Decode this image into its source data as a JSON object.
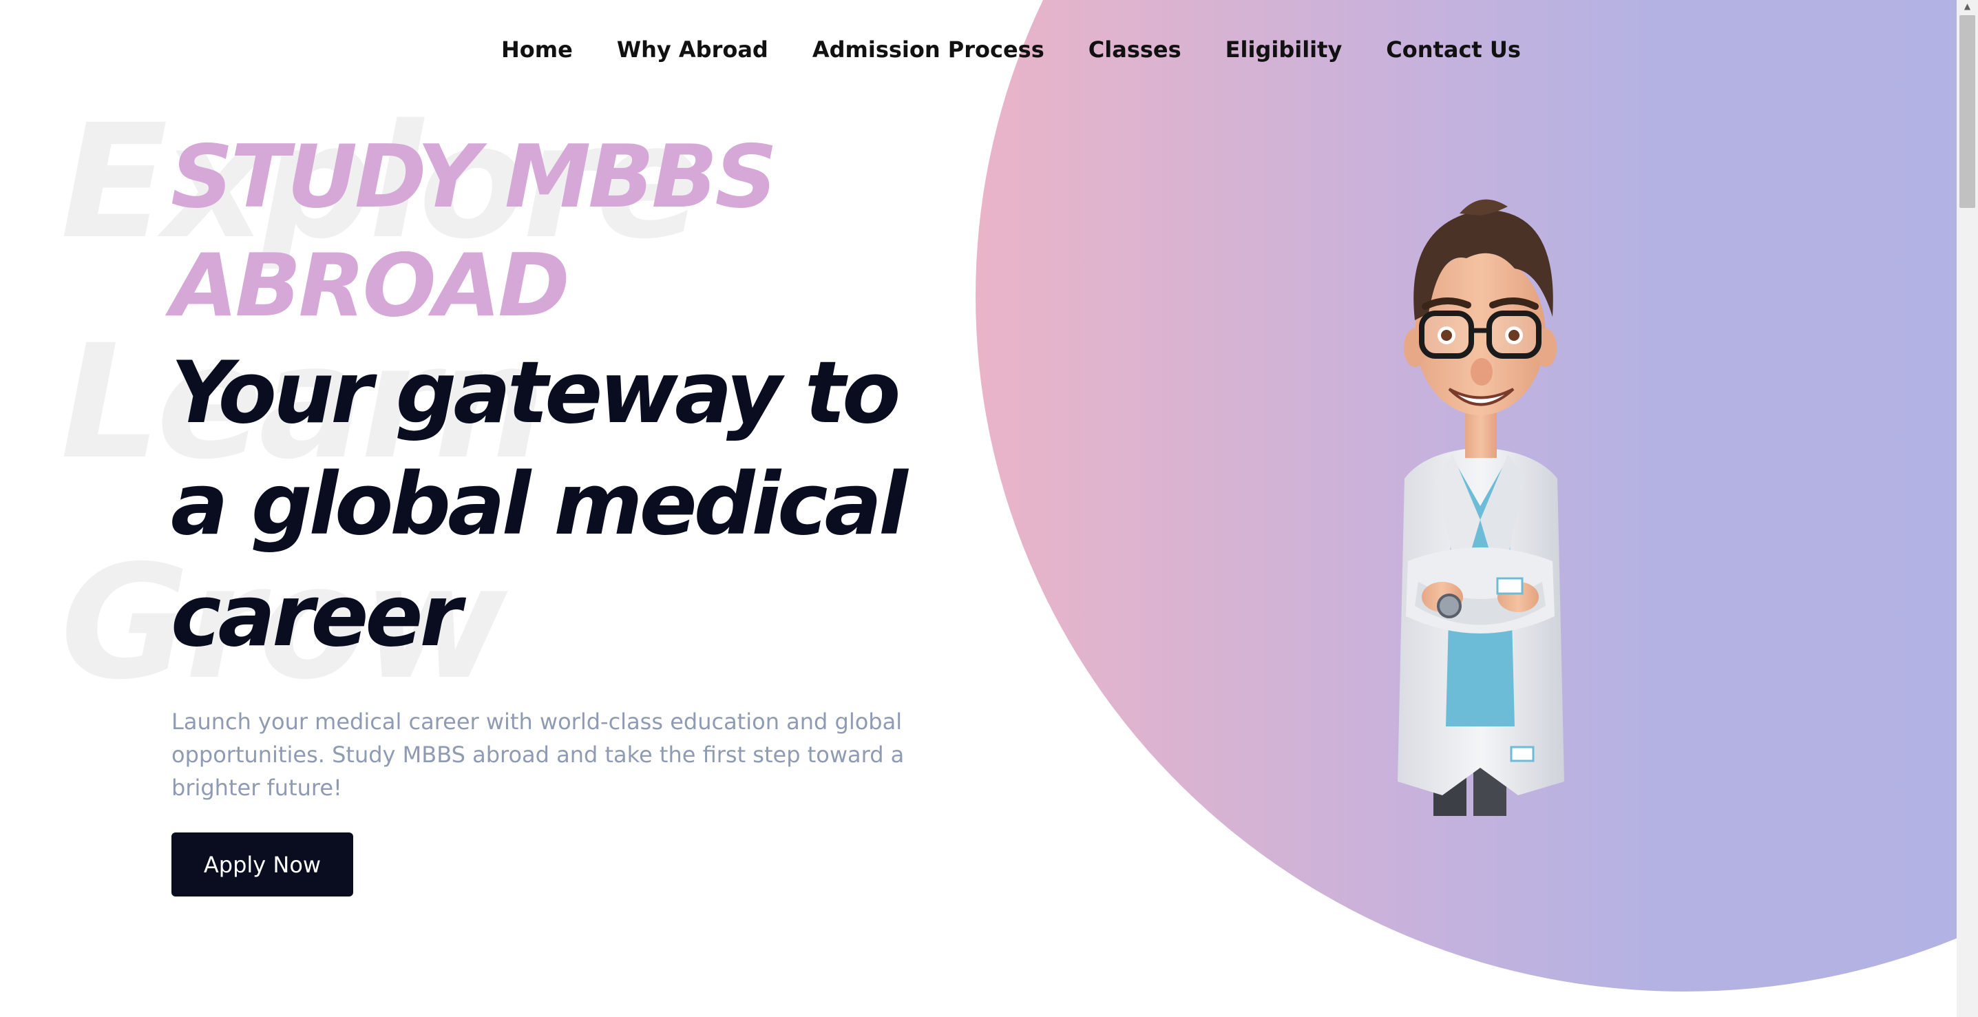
{
  "nav": {
    "items": [
      {
        "label": "Home"
      },
      {
        "label": "Why Abroad"
      },
      {
        "label": "Admission Process"
      },
      {
        "label": "Classes"
      },
      {
        "label": "Eligibility"
      },
      {
        "label": "Contact Us"
      }
    ]
  },
  "hero": {
    "watermark": [
      "Explore",
      "Learn",
      "Grow"
    ],
    "eyebrow_line1": "STUDY MBBS",
    "eyebrow_line2": "ABROAD",
    "headline_line1": "Your gateway to",
    "headline_line2": "a global medical",
    "headline_line3": "career",
    "description": "Launch your medical career with world-class education and global opportunities. Study MBBS abroad and take the first step toward a brighter future!",
    "cta_label": "Apply Now"
  },
  "colors": {
    "accent_pink": "#d6a8d8",
    "dark": "#090d1f",
    "muted_text": "#8f9bb3",
    "gradient_start": "#eab4c8",
    "gradient_end": "#b1b2e4"
  },
  "icons": {
    "hero_image": "doctor-illustration",
    "scroll_up": "chevron-up-icon"
  }
}
